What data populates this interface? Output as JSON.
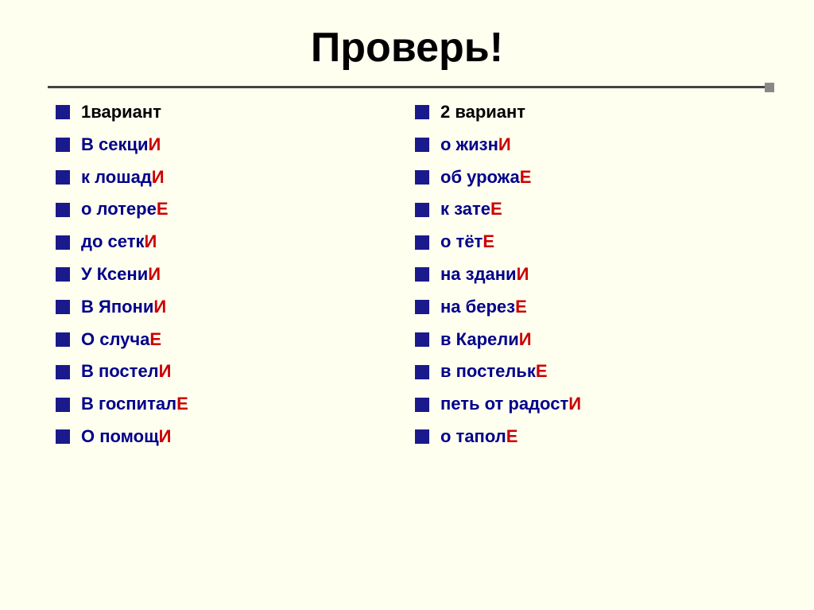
{
  "title": "Проверь!",
  "column1": {
    "header": "1вариант",
    "items": [
      {
        "text": "В секци",
        "ending": "И"
      },
      {
        "text": "к лошад",
        "ending": "И"
      },
      {
        "text": "о лотере",
        "ending": "Е"
      },
      {
        "text": "до сетк",
        "ending": "И"
      },
      {
        "text": "У Ксени",
        "ending": "И"
      },
      {
        "text": "В Япони",
        "ending": "И"
      },
      {
        "text": "О случа",
        "ending": "Е"
      },
      {
        "text": "В постел",
        "ending": "И"
      },
      {
        "text": "В госпитал",
        "ending": "Е"
      },
      {
        "text": "О помощ",
        "ending": "И"
      }
    ]
  },
  "column2": {
    "header": "2 вариант",
    "items": [
      {
        "text": "о жизн",
        "ending": "И"
      },
      {
        "text": "об урожа",
        "ending": "Е"
      },
      {
        "text": "к зате",
        "ending": "Е"
      },
      {
        "text": "о тёт",
        "ending": "Е"
      },
      {
        "text": "на здани",
        "ending": "И"
      },
      {
        "text": "на берез",
        "ending": "Е"
      },
      {
        "text": "в Карели",
        "ending": "И"
      },
      {
        "text": "в постельк",
        "ending": "Е"
      },
      {
        "text": "петь от радост",
        "ending": "И"
      },
      {
        "text": "о тапол",
        "ending": "Е"
      }
    ]
  }
}
